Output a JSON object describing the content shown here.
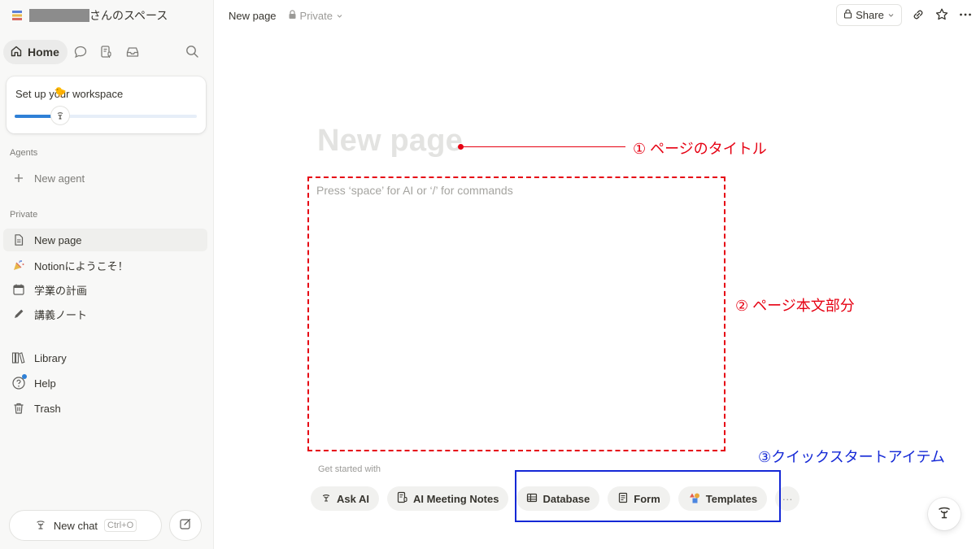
{
  "workspace": {
    "name": "さんのスペース"
  },
  "sidebar": {
    "home_label": "Home",
    "setup": {
      "title": "Set up your workspace",
      "progress": 0.25
    },
    "agents_label": "Agents",
    "new_agent": "New agent",
    "private_label": "Private",
    "pages": [
      {
        "label": "New page",
        "icon": "page-icon"
      },
      {
        "label": "Notionにようこそ！",
        "icon": "party-popper-icon"
      },
      {
        "label": "学業の計画",
        "icon": "calendar-icon"
      },
      {
        "label": "講義ノート",
        "icon": "pencil-icon"
      }
    ],
    "library": "Library",
    "help": "Help",
    "trash": "Trash",
    "new_chat": "New chat",
    "new_chat_shortcut": "Ctrl+O"
  },
  "topbar": {
    "breadcrumb_page": "New page",
    "breadcrumb_privacy": "Private",
    "share": "Share"
  },
  "page": {
    "title_placeholder": "New page",
    "body_placeholder": "Press ‘space’ for AI or ‘/’ for commands",
    "get_started": "Get started with",
    "quick_actions": [
      "Ask AI",
      "AI Meeting Notes",
      "Database",
      "Form",
      "Templates"
    ],
    "more": "···"
  },
  "annotations": {
    "title": "① ページのタイトル",
    "body": "② ページ本文部分",
    "quick_start": "③クイックスタートアイテム",
    "colors": {
      "red": "#e60012",
      "blue": "#1428d6"
    }
  },
  "colors": {
    "accent": "#2f80d6",
    "sidebar_bg": "#f8f8f7"
  }
}
